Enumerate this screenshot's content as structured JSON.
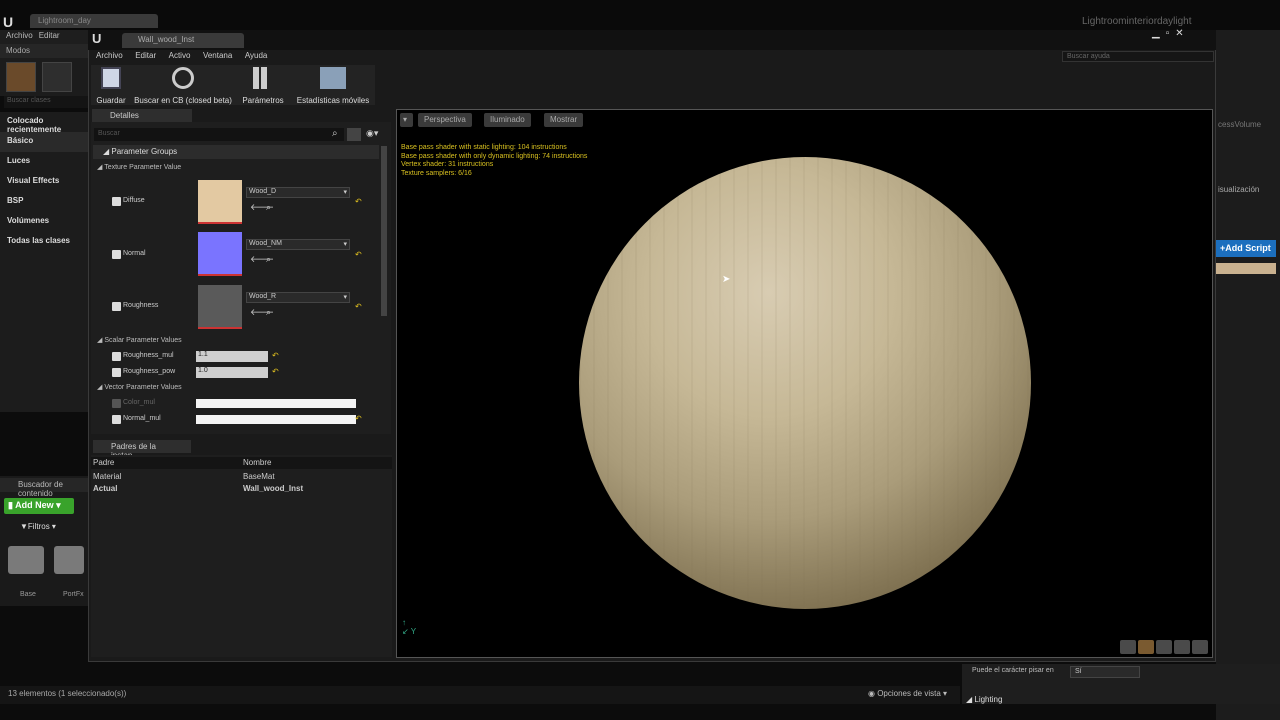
{
  "back_editor": {
    "tab_title": "Lightroom_day",
    "window_title": "Lightroominteriordaylight",
    "menu": [
      "Archivo",
      "Editar"
    ],
    "modes_label": "Modos",
    "search_classes_placeholder": "Buscar clases",
    "categories": [
      "Colocado recientemente",
      "Básico",
      "Luces",
      "Visual Effects",
      "BSP",
      "Volúmenes",
      "Todas las clases"
    ],
    "content_browser_title": "Buscador de contenido",
    "add_new_label": "Add New",
    "filters_label": "Filtros",
    "search_short": "Sear",
    "folders": [
      "Base",
      "PortFx"
    ],
    "status_text": "13 elementos (1 seleccionado(s))",
    "view_options_label": "Opciones de vista",
    "right_panel": {
      "volume_text": "cessVolume",
      "visualization_text": "isualización",
      "add_script_label": "Add Script"
    },
    "character_step_label": "Puede el carácter pisar en",
    "character_step_value": "Sí",
    "lighting_section": "Lighting"
  },
  "editor": {
    "tab_title": "Wall_wood_Inst",
    "menu": [
      "Archivo",
      "Editar",
      "Activo",
      "Ventana",
      "Ayuda"
    ],
    "help_search_placeholder": "Buscar ayuda",
    "toolbar": [
      {
        "label": "Guardar",
        "icon": "save-icon"
      },
      {
        "label": "Buscar en CB (closed beta)",
        "icon": "find-in-cb-icon"
      },
      {
        "label": "Parámetros",
        "icon": "parameters-icon"
      },
      {
        "label": "Estadísticas móviles",
        "icon": "mobile-stats-icon"
      }
    ],
    "details": {
      "tab_label": "Detalles",
      "search_placeholder": "Buscar",
      "parameter_groups_label": "Parameter Groups",
      "texture_group_label": "Texture Parameter Value",
      "textures": [
        {
          "name": "Diffuse",
          "asset": "Wood_D",
          "color": "#e3c9a2"
        },
        {
          "name": "Normal",
          "asset": "Wood_NM",
          "color": "#7a74ff"
        },
        {
          "name": "Roughness",
          "asset": "Wood_R",
          "color": "#5a5a5a"
        }
      ],
      "scalar_group_label": "Scalar Parameter Values",
      "scalars": [
        {
          "name": "Roughness_mul",
          "value": "1.1"
        },
        {
          "name": "Roughness_pow",
          "value": "1.0"
        }
      ],
      "vector_group_label": "Vector Parameter Values",
      "vectors": [
        {
          "name": "Color_mul",
          "enabled": false
        },
        {
          "name": "Normal_mul",
          "enabled": true
        }
      ]
    },
    "parents": {
      "tab_label": "Padres de la instan",
      "col_parent": "Padre",
      "col_name": "Nombre",
      "rows": [
        {
          "parent": "Material",
          "name": "BaseMat"
        },
        {
          "parent": "Actual",
          "name": "Wall_wood_Inst"
        }
      ]
    },
    "viewport": {
      "buttons": [
        "Perspectiva",
        "Iluminado",
        "Mostrar"
      ],
      "stats": [
        "Base pass shader with static lighting: 104 instructions",
        "Base pass shader with only dynamic lighting: 74 instructions",
        "Vertex shader: 31 instructions",
        "Texture samplers: 6/16"
      ]
    }
  }
}
